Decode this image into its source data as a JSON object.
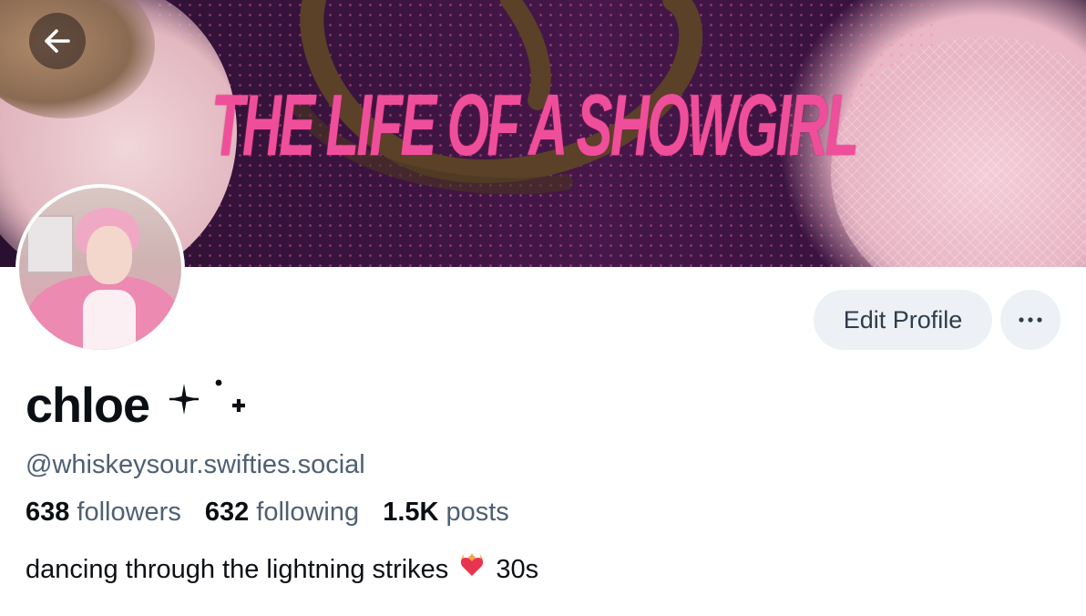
{
  "banner": {
    "title": "THE LIFE OF A SHOWGIRL",
    "accent_color": "#ef4f9a"
  },
  "nav": {
    "back_icon": "arrow-left-icon"
  },
  "profile": {
    "display_name": "chloe",
    "name_decoration": "✦˙₊",
    "handle": "@whiskeysour.swifties.social",
    "stats": [
      {
        "value": "638",
        "label": "followers"
      },
      {
        "value": "632",
        "label": "following"
      },
      {
        "value": "1.5K",
        "label": "posts"
      }
    ],
    "bio_text": "dancing through the lightning strikes",
    "bio_emoji_icon": "heart-on-fire-icon",
    "bio_suffix": "30s"
  },
  "actions": {
    "edit_label": "Edit Profile",
    "more_icon": "ellipsis-icon"
  },
  "colors": {
    "button_bg": "#edf1f5",
    "secondary_text": "#4f6072",
    "primary_text": "#0b0f14"
  }
}
